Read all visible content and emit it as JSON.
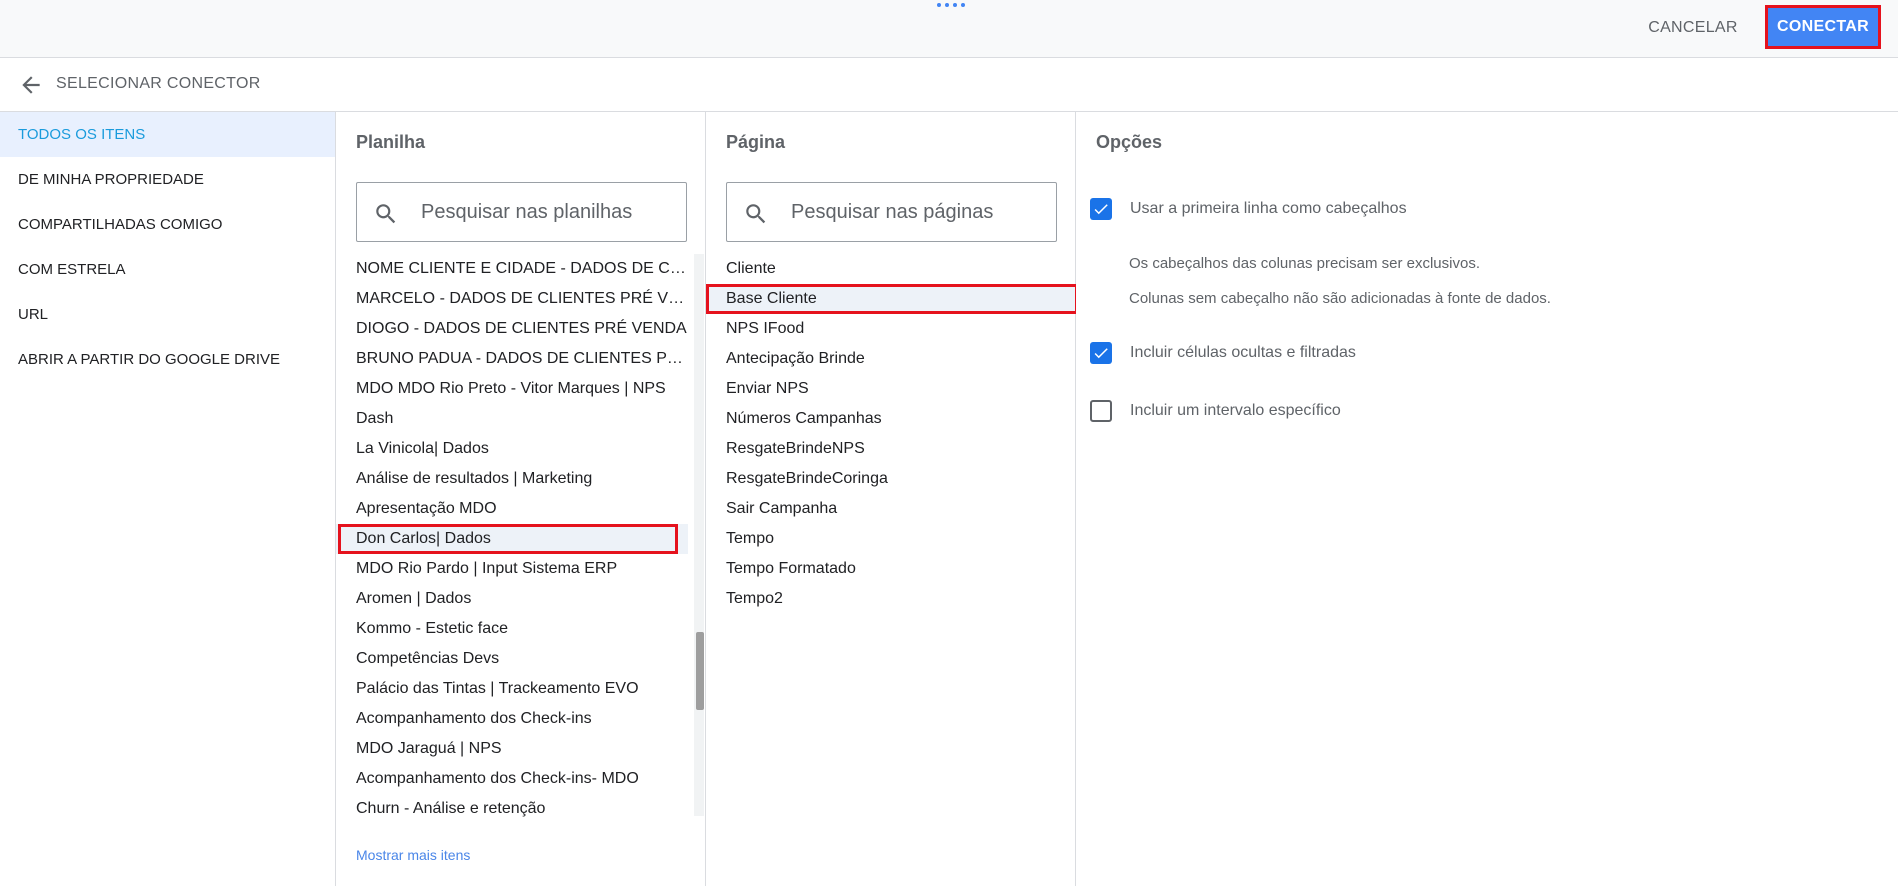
{
  "topbar": {
    "cancel_label": "CANCELAR",
    "connect_label": "CONECTAR"
  },
  "header": {
    "title": "SELECIONAR CONECTOR"
  },
  "leftnav": {
    "items": [
      {
        "label": "TODOS OS ITENS",
        "active": true
      },
      {
        "label": "DE MINHA PROPRIEDADE"
      },
      {
        "label": "COMPARTILHADAS COMIGO"
      },
      {
        "label": "COM ESTRELA"
      },
      {
        "label": "URL"
      },
      {
        "label": "ABRIR A PARTIR DO GOOGLE DRIVE"
      }
    ]
  },
  "planilha": {
    "title": "Planilha",
    "search_placeholder": "Pesquisar nas planilhas",
    "items": [
      "NOME CLIENTE E CIDADE - DADOS DE CLIE...",
      "MARCELO - DADOS DE CLIENTES PRÉ VEN...",
      "DIOGO - DADOS DE CLIENTES PRÉ VENDA",
      "BRUNO PADUA - DADOS DE CLIENTES PRÉ ...",
      "MDO MDO Rio Preto - Vitor Marques | NPS",
      "Dash",
      "La Vinicola| Dados",
      "Análise de resultados | Marketing",
      "Apresentação MDO",
      "Don Carlos| Dados",
      "MDO Rio Pardo | Input Sistema ERP",
      "Aromen | Dados",
      "Kommo - Estetic face",
      "Competências Devs",
      "Palácio das Tintas | Trackeamento EVO",
      "Acompanhamento dos Check-ins",
      "MDO Jaraguá | NPS",
      "Acompanhamento dos Check-ins- MDO",
      "Churn - Análise e retenção"
    ],
    "selected_index": 9,
    "more_label": "Mostrar mais itens"
  },
  "pagina": {
    "title": "Página",
    "search_placeholder": "Pesquisar nas páginas",
    "items": [
      "Cliente",
      "Base Cliente",
      "NPS IFood",
      "Antecipação Brinde",
      "Enviar NPS",
      "Números Campanhas",
      "ResgateBrindeNPS",
      "ResgateBrindeCoringa",
      "Sair Campanha",
      "Tempo",
      "Tempo Formatado",
      "Tempo2"
    ],
    "selected_index": 1
  },
  "opcoes": {
    "title": "Opções",
    "first_row_header": {
      "label": "Usar a primeira linha como cabeçalhos",
      "checked": true
    },
    "note_1": "Os cabeçalhos das colunas precisam ser exclusivos.",
    "note_2": "Colunas sem cabeçalho não são adicionadas à fonte de dados.",
    "include_hidden": {
      "label": "Incluir células ocultas e filtradas",
      "checked": true
    },
    "specific_range": {
      "label": "Incluir um intervalo específico",
      "checked": false
    }
  },
  "colors": {
    "primary": "#4285f4",
    "highlight_outline": "#e5121d",
    "nav_active_text": "#1a9bdc",
    "nav_active_bg": "#e8f0fe",
    "checkbox_on": "#1a73e8"
  }
}
